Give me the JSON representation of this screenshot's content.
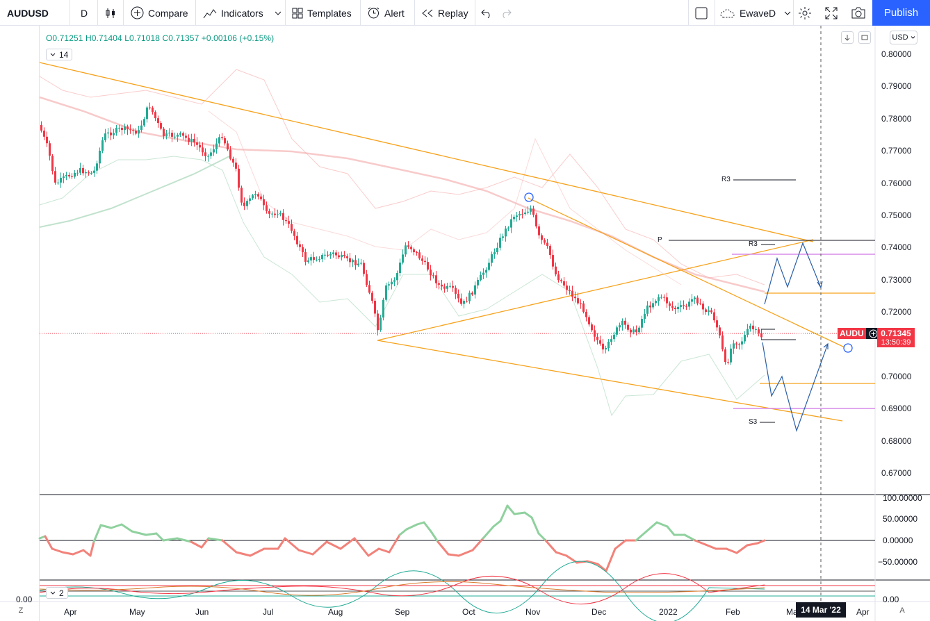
{
  "toolbar": {
    "symbol": "AUDUSD",
    "interval": "D",
    "compare": "Compare",
    "indicators": "Indicators",
    "templates": "Templates",
    "alert": "Alert",
    "replay": "Replay",
    "layout_name": "EwaveD",
    "publish": "Publish"
  },
  "legend": {
    "ohlc": "O0.71251 H0.71404 L0.71018 C0.71357 +0.00106 (+0.15%)",
    "indicator_param": "14",
    "indicator2_param": "2"
  },
  "currency": "USD",
  "price_scale": [
    "0.80000",
    "0.79000",
    "0.78000",
    "0.77000",
    "0.76000",
    "0.75000",
    "0.74000",
    "0.73000",
    "0.72000",
    "0.71000",
    "0.70000",
    "0.69000",
    "0.68000",
    "0.67000"
  ],
  "osc_scale": [
    "100.00000",
    "50.00000",
    "0.00000",
    "−50.00000"
  ],
  "osc2_scale_right": "0.00",
  "osc2_scale_left": "0.00",
  "time_axis": [
    "Apr",
    "May",
    "Jun",
    "Jul",
    "Aug",
    "Sep",
    "Oct",
    "Nov",
    "Dec",
    "2022",
    "Feb",
    "Ma",
    "Apr"
  ],
  "crosshair_date": "14 Mar '22",
  "price_label": {
    "symbol": "AUDU",
    "price": "0.71345",
    "countdown": "13:50:39"
  },
  "pivots": {
    "r3_upper": "R3",
    "p": "P",
    "r3_lower": "R3",
    "s3": "S3"
  },
  "axis_corner_left": "Z",
  "axis_corner_right": "A",
  "colors": {
    "up": "#22ab94",
    "down": "#f23645",
    "trend": "#f7a21b",
    "projection": "#2a5ea8",
    "accent": "#2962ff"
  }
}
